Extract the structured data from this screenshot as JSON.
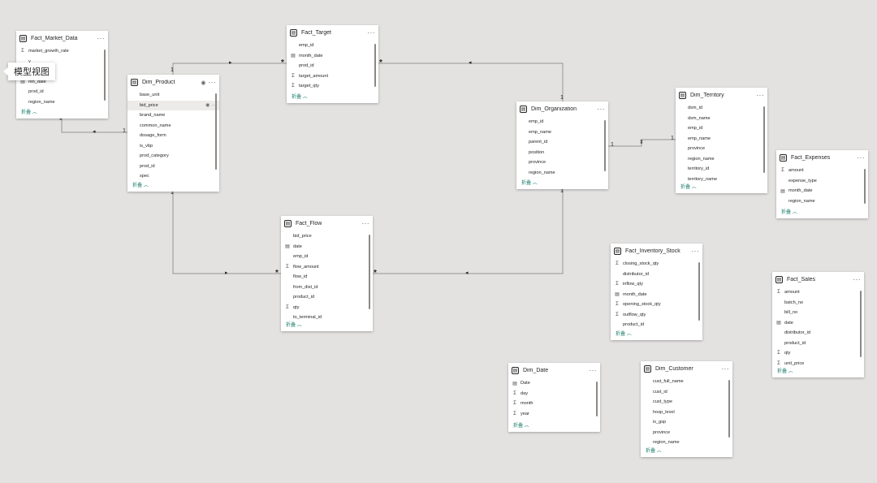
{
  "tooltip": "模型视图",
  "collapse_label": "折叠",
  "tables": {
    "fact_market_data": {
      "name": "Fact_Market_Data",
      "fields": [
        {
          "icon": "sum",
          "label": "market_growth_rate"
        },
        {
          "icon": "",
          "label": "y"
        },
        {
          "icon": "",
          "label": ""
        },
        {
          "icon": "cal",
          "label": "nth_date"
        },
        {
          "icon": "",
          "label": "prod_id"
        },
        {
          "icon": "",
          "label": "region_name"
        }
      ]
    },
    "dim_product": {
      "name": "Dim_Product",
      "fields": [
        {
          "icon": "",
          "label": "base_unit"
        },
        {
          "icon": "",
          "label": "bid_price"
        },
        {
          "icon": "",
          "label": "brand_name"
        },
        {
          "icon": "",
          "label": "common_name"
        },
        {
          "icon": "",
          "label": "dosage_form"
        },
        {
          "icon": "",
          "label": "is_vbp"
        },
        {
          "icon": "",
          "label": "prod_category"
        },
        {
          "icon": "",
          "label": "prod_id"
        },
        {
          "icon": "",
          "label": "spec"
        }
      ]
    },
    "fact_target": {
      "name": "Fact_Target",
      "fields": [
        {
          "icon": "",
          "label": "emp_id"
        },
        {
          "icon": "cal",
          "label": "month_date"
        },
        {
          "icon": "",
          "label": "prod_id"
        },
        {
          "icon": "sum",
          "label": "target_amount"
        },
        {
          "icon": "sum",
          "label": "target_qty"
        }
      ]
    },
    "dim_organization": {
      "name": "Dim_Organization",
      "fields": [
        {
          "icon": "",
          "label": "emp_id"
        },
        {
          "icon": "",
          "label": "emp_name"
        },
        {
          "icon": "",
          "label": "parent_id"
        },
        {
          "icon": "",
          "label": "position"
        },
        {
          "icon": "",
          "label": "province"
        },
        {
          "icon": "",
          "label": "region_name"
        }
      ]
    },
    "dim_territory": {
      "name": "Dim_Territory",
      "fields": [
        {
          "icon": "",
          "label": "dsm_id"
        },
        {
          "icon": "",
          "label": "dsm_name"
        },
        {
          "icon": "",
          "label": "emp_id"
        },
        {
          "icon": "",
          "label": "emp_name"
        },
        {
          "icon": "",
          "label": "province"
        },
        {
          "icon": "",
          "label": "region_name"
        },
        {
          "icon": "",
          "label": "territory_id"
        },
        {
          "icon": "",
          "label": "territory_name"
        }
      ]
    },
    "fact_expenses": {
      "name": "Fact_Expenses",
      "fields": [
        {
          "icon": "sum",
          "label": "amount"
        },
        {
          "icon": "",
          "label": "expense_type"
        },
        {
          "icon": "cal",
          "label": "month_date"
        },
        {
          "icon": "",
          "label": "region_name"
        }
      ]
    },
    "fact_flow": {
      "name": "Fact_Flow",
      "fields": [
        {
          "icon": "",
          "label": "bid_price"
        },
        {
          "icon": "cal",
          "label": "date"
        },
        {
          "icon": "",
          "label": "emp_id"
        },
        {
          "icon": "sum",
          "label": "flow_amount"
        },
        {
          "icon": "",
          "label": "flow_id"
        },
        {
          "icon": "",
          "label": "from_dist_id"
        },
        {
          "icon": "",
          "label": "product_id"
        },
        {
          "icon": "sum",
          "label": "qty"
        },
        {
          "icon": "",
          "label": "to_terminal_id"
        }
      ]
    },
    "fact_inventory_stock": {
      "name": "Fact_Inventory_Stock",
      "fields": [
        {
          "icon": "sum",
          "label": "closing_stock_qty"
        },
        {
          "icon": "",
          "label": "distributor_id"
        },
        {
          "icon": "sum",
          "label": "inflow_qty"
        },
        {
          "icon": "cal",
          "label": "month_date"
        },
        {
          "icon": "sum",
          "label": "opening_stock_qty"
        },
        {
          "icon": "sum",
          "label": "outflow_qty"
        },
        {
          "icon": "",
          "label": "product_id"
        }
      ]
    },
    "fact_sales": {
      "name": "Fact_Sales",
      "fields": [
        {
          "icon": "sum",
          "label": "amount"
        },
        {
          "icon": "",
          "label": "batch_no"
        },
        {
          "icon": "",
          "label": "bill_no"
        },
        {
          "icon": "cal",
          "label": "date"
        },
        {
          "icon": "",
          "label": "distributor_id"
        },
        {
          "icon": "",
          "label": "product_id"
        },
        {
          "icon": "sum",
          "label": "qty"
        },
        {
          "icon": "sum",
          "label": "unit_price"
        }
      ]
    },
    "dim_date": {
      "name": "Dim_Date",
      "fields": [
        {
          "icon": "cal",
          "label": "Date"
        },
        {
          "icon": "sum",
          "label": "day"
        },
        {
          "icon": "sum",
          "label": "month"
        },
        {
          "icon": "sum",
          "label": "year"
        }
      ]
    },
    "dim_customer": {
      "name": "Dim_Customer",
      "fields": [
        {
          "icon": "",
          "label": "cust_full_name"
        },
        {
          "icon": "",
          "label": "cust_id"
        },
        {
          "icon": "",
          "label": "cust_type"
        },
        {
          "icon": "",
          "label": "hosp_level"
        },
        {
          "icon": "",
          "label": "is_gsp"
        },
        {
          "icon": "",
          "label": "province"
        },
        {
          "icon": "",
          "label": "region_name"
        }
      ]
    }
  },
  "markers": {
    "one": "1",
    "many": "*",
    "arrow_left": "◂",
    "arrow_right": "▸",
    "both": "⇕"
  }
}
